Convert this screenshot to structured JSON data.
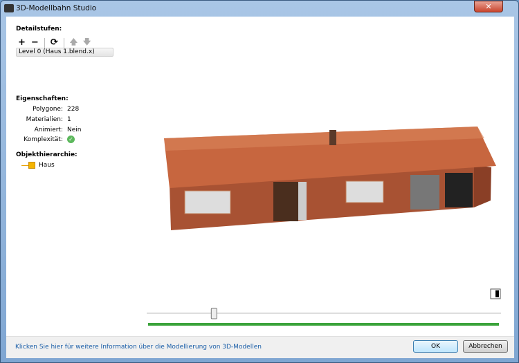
{
  "window": {
    "title": "3D-Modellbahn Studio",
    "close": "✕"
  },
  "lod": {
    "heading": "Detailstufen:",
    "add": "+",
    "remove": "−",
    "refresh": "⟳",
    "up": "🡅",
    "down": "🡇",
    "selected": "Level 0 (Haus 1.blend.x)"
  },
  "properties": {
    "heading": "Eigenschaften:",
    "rows": [
      {
        "label": "Polygone:",
        "value": "228"
      },
      {
        "label": "Materialien:",
        "value": "1"
      },
      {
        "label": "Animiert:",
        "value": "Nein"
      },
      {
        "label": "Komplexität:",
        "value": ""
      }
    ]
  },
  "hierarchy": {
    "heading": "Objekthierarchie:",
    "items": [
      "Haus"
    ]
  },
  "viewer": {
    "slider_value": 0.19,
    "progress": 1.0,
    "accent": "#3aa33a"
  },
  "footer": {
    "link": "Klicken Sie hier für weitere Information über die Modellierung von 3D-Modellen",
    "ok": "OK",
    "cancel": "Abbrechen"
  }
}
